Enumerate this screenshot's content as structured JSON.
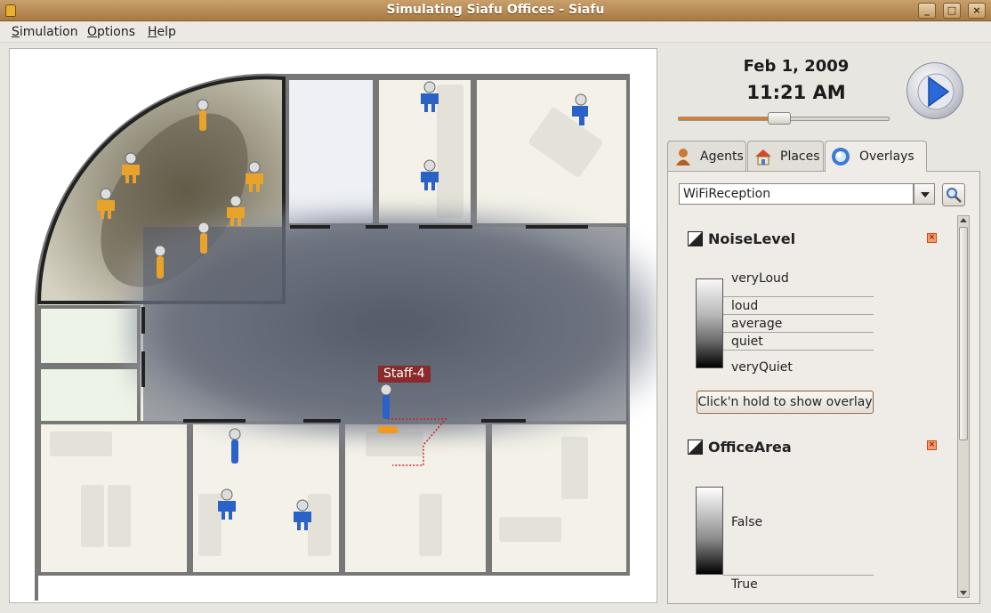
{
  "window": {
    "title": "Simulating Siafu Offices - Siafu",
    "controls": [
      "minimize-icon",
      "maximize-icon",
      "close-icon"
    ]
  },
  "menu": {
    "items": [
      {
        "label": "Simulation",
        "mnemonic": "S"
      },
      {
        "label": "Options",
        "mnemonic": "O"
      },
      {
        "label": "Help",
        "mnemonic": "H"
      }
    ]
  },
  "map": {
    "selected_agent_label": "Staff-4"
  },
  "clock": {
    "date": "Feb 1, 2009",
    "time": "11:21 AM",
    "speed_fraction": 0.48
  },
  "tabs": [
    {
      "label": "Agents",
      "icon": "agent-icon"
    },
    {
      "label": "Places",
      "icon": "house-icon"
    },
    {
      "label": "Overlays",
      "icon": "globe-icon",
      "active": true
    }
  ],
  "overlay_selector": {
    "value": "WiFiReception"
  },
  "overlays": [
    {
      "name": "NoiseLevel",
      "levels": [
        "veryLoud",
        "loud",
        "average",
        "quiet",
        "veryQuiet"
      ]
    },
    {
      "name": "OfficeArea",
      "levels": [
        "False",
        "True"
      ]
    }
  ],
  "hold_button_label": "Click'n hold to show overlay",
  "colors": {
    "titlebar": "#b8884f",
    "agent_blue": "#2a62c8",
    "agent_orange": "#e9a22a",
    "label_red": "#8a2a2a"
  }
}
